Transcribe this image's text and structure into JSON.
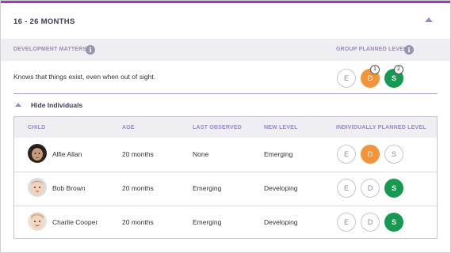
{
  "section": {
    "title": "16 - 26  MONTHS"
  },
  "development_matters": {
    "label": "DEVELOPMENT MATTERS",
    "group_planned_label": "GROUP PLANNED LEVEL",
    "statement": "Knows that things exist, even when out of sight.",
    "group_levels": [
      {
        "letter": "E",
        "badge": ""
      },
      {
        "letter": "D",
        "badge": "1"
      },
      {
        "letter": "S",
        "badge": "2"
      }
    ]
  },
  "toggle": {
    "label": "Hide Individuals"
  },
  "table": {
    "headers": {
      "child": "CHILD",
      "age": "AGE",
      "last_observed": "LAST OBSERVED",
      "new_level": "NEW LEVEL",
      "individual": "INDIVIDUALLY PLANNED LEVEL"
    },
    "rows": [
      {
        "name": "Alfie Allan",
        "age": "20 months",
        "last_observed": "None",
        "new_level": "Emerging",
        "levels": [
          "E",
          "D",
          "S"
        ],
        "selected": "D"
      },
      {
        "name": "Bob Brown",
        "age": "20 months",
        "last_observed": "Emerging",
        "new_level": "Developing",
        "levels": [
          "E",
          "D",
          "S"
        ],
        "selected": "S"
      },
      {
        "name": "Charlie Cooper",
        "age": "20 months",
        "last_observed": "Emerging",
        "new_level": "Developing",
        "levels": [
          "E",
          "D",
          "S"
        ],
        "selected": "S"
      }
    ]
  },
  "colors": {
    "accent": "#a23bb7",
    "emerging_selected": "#f2953a",
    "secure_selected": "#169a52",
    "header_label": "#9d86c6"
  }
}
